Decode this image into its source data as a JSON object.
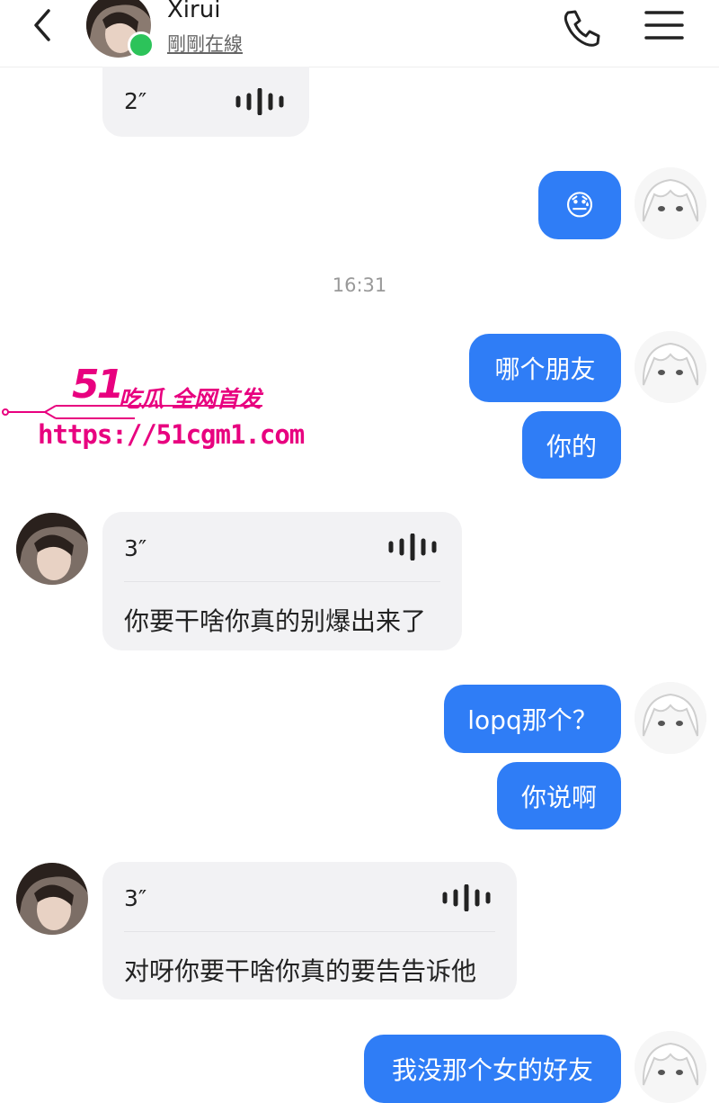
{
  "header": {
    "contact_name": "Xirui",
    "status": "剛剛在線"
  },
  "messages": {
    "voice1": {
      "duration": "2″"
    },
    "sticker_emoji": "😓",
    "timestamp": "16:31",
    "out1": "哪个朋友",
    "out2": "你的",
    "voice2": {
      "duration": "3″",
      "transcript": "你要干啥你真的别爆出来了"
    },
    "out3": "lopq那个？",
    "out4": "你说啊",
    "voice3": {
      "duration": "3″",
      "transcript": "对呀你要干啥你真的要告告诉他"
    },
    "out5": "我没那个女的好友"
  },
  "watermark": {
    "number": "51",
    "tagline": "吃瓜 全网首发",
    "url": "https://51cgm1.com"
  },
  "colors": {
    "bubble_out": "#2f7df6",
    "bubble_in": "#f2f2f4",
    "online": "#2cc35a",
    "watermark": "#e8007f"
  }
}
